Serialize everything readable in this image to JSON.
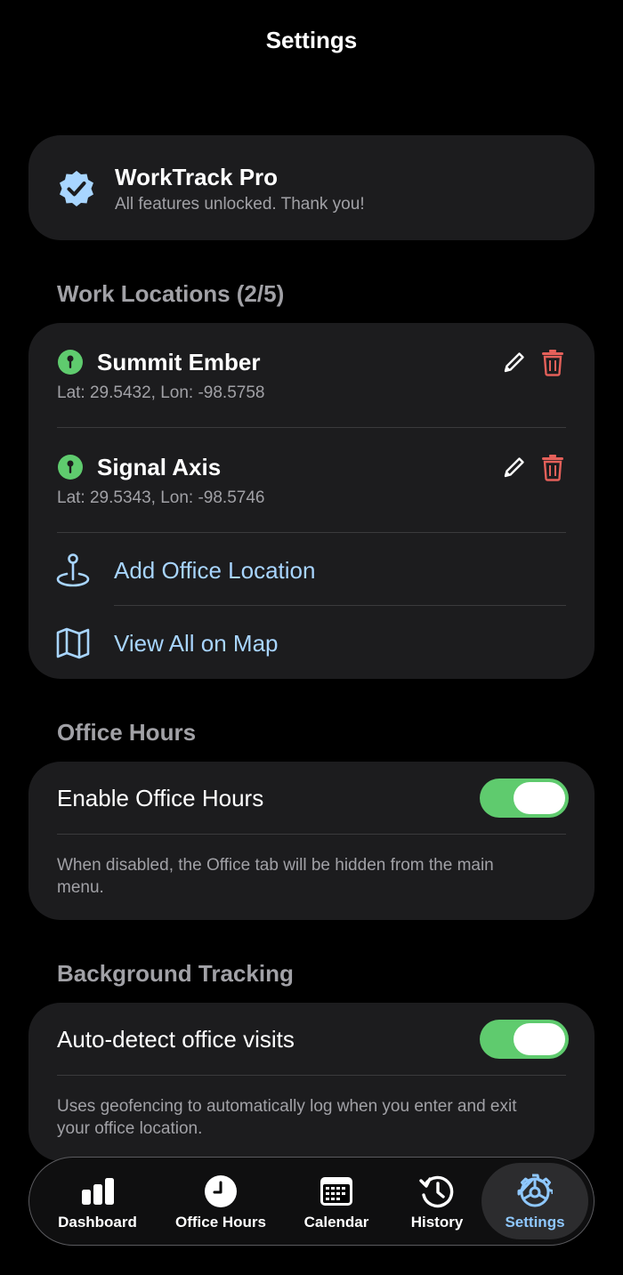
{
  "header": {
    "title": "Settings"
  },
  "pro": {
    "title": "WorkTrack Pro",
    "subtitle": "All features unlocked. Thank you!"
  },
  "locations": {
    "header": "Work Locations (2/5)",
    "items": [
      {
        "name": "Summit Ember",
        "coords": "Lat: 29.5432, Lon: -98.5758"
      },
      {
        "name": "Signal Axis",
        "coords": "Lat: 29.5343, Lon: -98.5746"
      }
    ],
    "add_label": "Add Office Location",
    "map_label": "View All on Map"
  },
  "office_hours": {
    "header": "Office Hours",
    "toggle_label": "Enable Office Hours",
    "enabled": true,
    "description": "When disabled, the Office tab will be hidden from the main menu."
  },
  "background": {
    "header": "Background Tracking",
    "toggle_label": "Auto-detect office visits",
    "enabled": true,
    "description": "Uses geofencing to automatically log when you enter and exit your office location."
  },
  "tabs": [
    {
      "label": "Dashboard",
      "icon": "bar-chart-icon"
    },
    {
      "label": "Office Hours",
      "icon": "clock-icon"
    },
    {
      "label": "Calendar",
      "icon": "calendar-icon"
    },
    {
      "label": "History",
      "icon": "history-icon"
    },
    {
      "label": "Settings",
      "icon": "gear-icon",
      "active": true
    }
  ],
  "colors": {
    "accent": "#8fc8ff",
    "toggle_on": "#5fcb6e",
    "pin": "#5fcb6e",
    "delete": "#e5605a",
    "card": "#1c1c1e"
  }
}
